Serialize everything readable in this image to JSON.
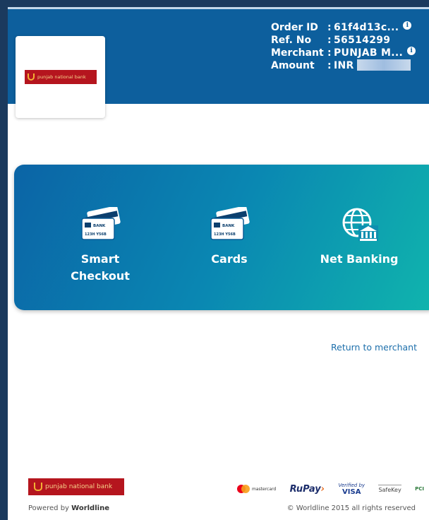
{
  "header": {
    "logo_text": "punjab national bank",
    "order_id_label": "Order ID",
    "order_id_value": "61f4d13c...",
    "ref_label": "Ref. No",
    "ref_value": "56514299",
    "merchant_label": "Merchant",
    "merchant_value": "PUNJAB M...",
    "amount_label": "Amount",
    "amount_value": "INR",
    "separator": ":",
    "info_glyph": "i"
  },
  "payment_modes": [
    {
      "label_line1": "Smart",
      "label_line2": "Checkout",
      "icon": "bank-card-icon"
    },
    {
      "label_line1": "Cards",
      "label_line2": "",
      "icon": "bank-card-icon"
    },
    {
      "label_line1": "Net Banking",
      "label_line2": "",
      "icon": "globe-bank-icon"
    }
  ],
  "card_icon_text": {
    "bank": "BANK",
    "numbers": "123H Y56B"
  },
  "return_link": "Return to merchant",
  "footer": {
    "logo_text": "punjab national bank",
    "powered_prefix": "Powered by",
    "powered_brand": "Worldline",
    "copyright": "© Worldline 2015 all rights reserved",
    "brands": {
      "mastercard": "mastercard",
      "rupay_a": "RuPay",
      "rupay_b": "›",
      "vbv_top": "Verified by",
      "vbv_bottom": "VISA",
      "safekey": "SafeKey",
      "pci": "PCI"
    }
  },
  "colors": {
    "header_blue": "#0d5f9d",
    "panel_start": "#0b64a6",
    "panel_end": "#10b5ad",
    "brand_red": "#b5151e",
    "link_blue": "#1d6fab"
  }
}
